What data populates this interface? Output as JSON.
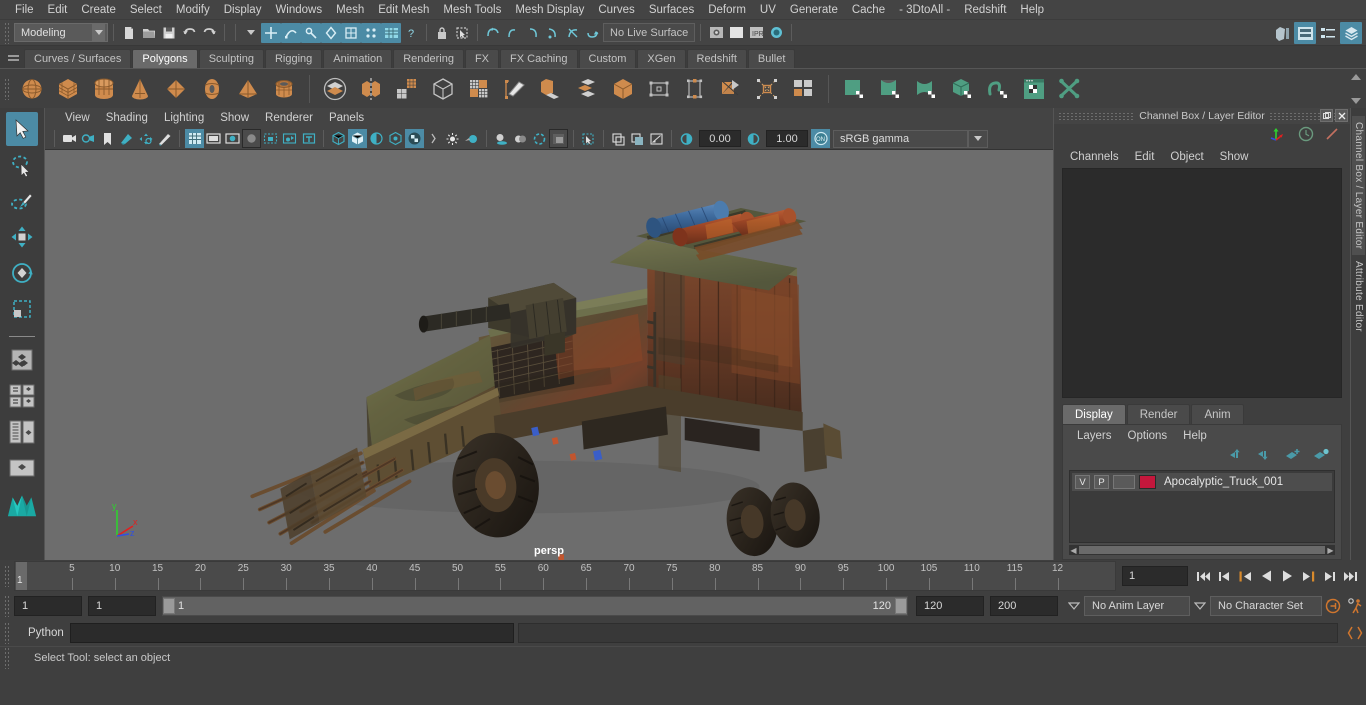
{
  "app": {
    "name": "Autodesk Maya",
    "theme_bg": "#3f3f3f",
    "accent": "#4c8ba5"
  },
  "menubar": {
    "items": [
      "File",
      "Edit",
      "Create",
      "Select",
      "Modify",
      "Display",
      "Windows",
      "Mesh",
      "Edit Mesh",
      "Mesh Tools",
      "Mesh Display",
      "Curves",
      "Surfaces",
      "Deform",
      "UV",
      "Generate",
      "Cache",
      "- 3DtoAll -",
      "Redshift",
      "Help"
    ]
  },
  "status_line": {
    "menuset": "Modeling",
    "live_surface": "No Live Surface",
    "snap_toggles": [
      "snap-to-grid",
      "snap-to-curve",
      "snap-to-point",
      "snap-to-projected-center",
      "snap-to-view-plane",
      "snap-make-live",
      "snap-to-pixel",
      "snap-help"
    ],
    "render_buttons": [
      "render-current-frame",
      "ipr-render",
      "render-settings",
      "hypershade-render"
    ],
    "right_buttons": [
      "show-hide-modeling-toolkit",
      "show-hide-attribute-editor",
      "show-hide-tool-settings",
      "show-hide-channel-box"
    ]
  },
  "shelf": {
    "tabs": [
      "Curves / Surfaces",
      "Polygons",
      "Sculpting",
      "Rigging",
      "Animation",
      "Rendering",
      "FX",
      "FX Caching",
      "Custom",
      "XGen",
      "Redshift",
      "Bullet"
    ],
    "active_tab": "Polygons",
    "icons": [
      {
        "name": "poly-sphere",
        "color": "#d08b4f",
        "shape": "sphere"
      },
      {
        "name": "poly-cube",
        "color": "#d08b4f",
        "shape": "cube"
      },
      {
        "name": "poly-cylinder",
        "color": "#d08b4f",
        "shape": "cylinder"
      },
      {
        "name": "poly-cone",
        "color": "#d08b4f",
        "shape": "cone"
      },
      {
        "name": "poly-plane",
        "color": "#d08b4f",
        "shape": "diamond"
      },
      {
        "name": "poly-torus",
        "color": "#d08b4f",
        "shape": "torus"
      },
      {
        "name": "poly-prism",
        "color": "#d08b4f",
        "shape": "pyramid"
      },
      {
        "name": "poly-pipe",
        "color": "#d08b4f",
        "shape": "pipe"
      },
      {
        "name": "combine",
        "color": "#d08b4f",
        "shape": "combine"
      },
      {
        "name": "separate",
        "color": "#d08b4f",
        "shape": "separate"
      },
      {
        "name": "mirror-geometry",
        "color": "#d08b4f",
        "shape": "mirror"
      },
      {
        "name": "smooth",
        "color": "#cccccc",
        "shape": "grid"
      },
      {
        "name": "boolean",
        "color": "#cccccc",
        "shape": "boolcube"
      },
      {
        "name": "extrude",
        "color": "#d08b4f",
        "shape": "quad"
      },
      {
        "name": "multi-cut",
        "color": "#d08b4f",
        "shape": "knife"
      },
      {
        "name": "bevel",
        "color": "#d08b4f",
        "shape": "bevel"
      },
      {
        "name": "bridge",
        "color": "#cccccc",
        "shape": "layers"
      },
      {
        "name": "append-polygon",
        "color": "#d08b4f",
        "shape": "cube2"
      },
      {
        "name": "wedge",
        "color": "#cccccc",
        "shape": "square-outline"
      },
      {
        "name": "poke-face",
        "color": "#cccccc",
        "shape": "dots-square"
      },
      {
        "name": "quad-draw",
        "color": "#d08b4f",
        "shape": "quaddraw"
      },
      {
        "name": "target-weld",
        "color": "#d08b4f",
        "shape": "target"
      },
      {
        "name": "tiles",
        "color": "#cccccc",
        "shape": "tiles"
      },
      {
        "name": "uv-plane",
        "color": "#5aa88a",
        "shape": "uvplane"
      },
      {
        "name": "uv-cylindrical",
        "color": "#5aa88a",
        "shape": "uvcyl"
      },
      {
        "name": "uv-spherical",
        "color": "#5aa88a",
        "shape": "uvsph"
      },
      {
        "name": "uv-automatic",
        "color": "#5aa88a",
        "shape": "uvauto"
      },
      {
        "name": "uv-unfold",
        "color": "#5aa88a",
        "shape": "uvunfold"
      },
      {
        "name": "uv-editor",
        "color": "#5aa88a",
        "shape": "uveditor"
      },
      {
        "name": "uv-cut-sew",
        "color": "#5aa88a",
        "shape": "uvcut"
      }
    ]
  },
  "toolbox": {
    "items": [
      {
        "name": "select-tool",
        "label": "Select Tool",
        "selected": true
      },
      {
        "name": "lasso-select-tool",
        "label": "Lasso Select Tool",
        "selected": false
      },
      {
        "name": "paint-select-tool",
        "label": "Paint Select Tool",
        "selected": false
      },
      {
        "name": "move-tool",
        "label": "Move Tool",
        "selected": false
      },
      {
        "name": "rotate-tool",
        "label": "Rotate Tool",
        "selected": false
      },
      {
        "name": "scale-tool",
        "label": "Scale Tool",
        "selected": false
      },
      {
        "name": "layout-single",
        "label": "Single Perspective View",
        "selected": false
      },
      {
        "name": "layout-four",
        "label": "Four View",
        "selected": false
      },
      {
        "name": "layout-outliner-persp",
        "label": "Outliner / Persp",
        "selected": false
      },
      {
        "name": "layout-persp-graph",
        "label": "Persp / Graph Editor",
        "selected": false
      },
      {
        "name": "maya-logo",
        "label": "Maya",
        "selected": false
      }
    ]
  },
  "viewport": {
    "menus": [
      "View",
      "Shading",
      "Lighting",
      "Show",
      "Renderer",
      "Panels"
    ],
    "camera_label": "persp",
    "exposure": "0.00",
    "gamma": "1.00",
    "color_space": "sRGB gamma",
    "gate_toggle": "ON",
    "background_color": "#6d6d6d",
    "axis_gizmo": {
      "x": "x",
      "y": "y",
      "z": "z",
      "x_color": "#e02020",
      "y_color": "#2fd02f",
      "z_color": "#3050e0"
    },
    "toolbar_icons": [
      "select-camera",
      "lock-camera",
      "bookmark",
      "image-plane",
      "two-d-pan-zoom",
      "grease-pencil",
      "grid-toggle",
      "film-gate",
      "resolution-gate",
      "gate-mask",
      "xray-joints",
      "xray-active",
      "film-origin",
      "wireframe",
      "shaded",
      "shaded-textured-off",
      "shaded-wireframe",
      "texture-toggle",
      "hw-texture",
      "lighting-default",
      "lighting-all",
      "shadows",
      "ao-toggle",
      "aa-toggle",
      "motion-blur",
      "isolate-select",
      "xray-mode",
      "xray-joint-mode",
      "xray-component",
      "exposure-icon",
      "gamma-icon",
      "view-transform-enable"
    ],
    "model": {
      "name": "Apocalyptic Truck",
      "description": "Rusty post-apocalyptic 6x6 military truck with roof-mounted minigun, blue and red fuel barrels on roof rack, spiked ram bumper with rebar spears, camo-green weathered armor panels"
    }
  },
  "channel_box": {
    "panel_title": "Channel Box / Layer Editor",
    "menus": [
      "Channels",
      "Edit",
      "Object",
      "Show"
    ],
    "contents": "",
    "window_buttons": [
      "undock-icon",
      "close-icon"
    ]
  },
  "layer_editor": {
    "tabs": [
      "Display",
      "Render",
      "Anim"
    ],
    "active_tab": "Display",
    "menus": [
      "Layers",
      "Options",
      "Help"
    ],
    "toolbar_icons": [
      "move-layer-up",
      "move-layer-down",
      "create-new-layer-from-selected",
      "create-new-layer"
    ],
    "layers": [
      {
        "visibility": "V",
        "playback": "P",
        "reference": "",
        "color": "#c4173c",
        "name": "Apocalyptic_Truck_001"
      }
    ]
  },
  "right_vtabs": [
    {
      "label": "Channel Box / Layer Editor",
      "selected": true
    },
    {
      "label": "Attribute Editor",
      "selected": false
    }
  ],
  "time_slider": {
    "start_visible": 1,
    "tick_labels": [
      "5",
      "10",
      "15",
      "20",
      "25",
      "30",
      "35",
      "40",
      "45",
      "50",
      "55",
      "60",
      "65",
      "70",
      "75",
      "80",
      "85",
      "90",
      "95",
      "100",
      "105",
      "110",
      "115",
      "12"
    ],
    "current_frame": "1",
    "frame_field": "1",
    "playback_buttons": [
      "go-to-start",
      "step-back-key",
      "step-back-frame",
      "play-backwards",
      "play-forwards",
      "step-forward-frame",
      "step-forward-key",
      "go-to-end"
    ]
  },
  "range_slider": {
    "anim_start": "1",
    "playback_start": "1",
    "range_left_label": "1",
    "range_right_label": "120",
    "playback_end": "120",
    "anim_end": "200",
    "anim_layer": "No Anim Layer",
    "character_set": "No Character Set",
    "buttons": [
      "auto-keyframe-toggle",
      "animation-preferences"
    ]
  },
  "command_line": {
    "language": "Python",
    "input_value": "",
    "output_value": "",
    "script_editor_icon": "script-editor-icon"
  },
  "help_line": {
    "message": "Select Tool: select an object"
  }
}
